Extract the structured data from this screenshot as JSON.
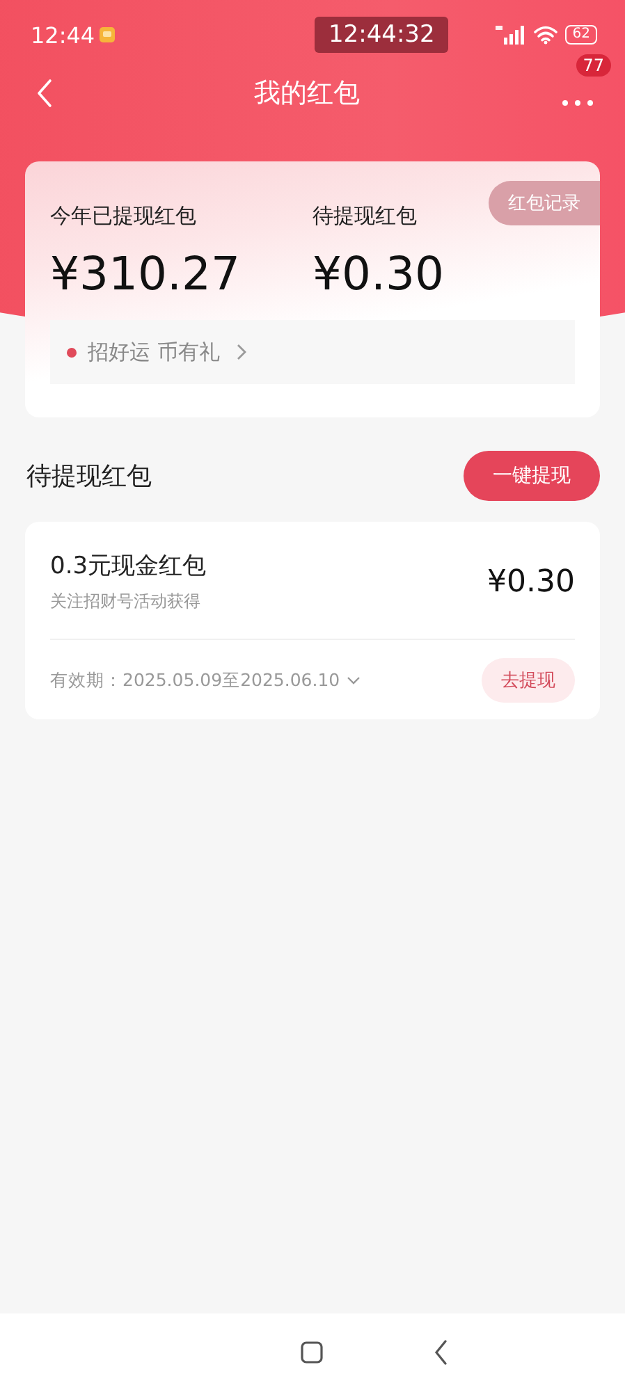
{
  "status_bar": {
    "time": "12:44",
    "clock": "12:44:32",
    "battery": "62"
  },
  "header": {
    "title": "我的红包",
    "badge": "77"
  },
  "summary": {
    "record_button": "红包记录",
    "stats": [
      {
        "label": "今年已提现红包",
        "amount": "¥310.27"
      },
      {
        "label": "待提现红包",
        "amount": "¥0.30"
      }
    ],
    "promo": "招好运 币有礼"
  },
  "pending": {
    "title": "待提现红包",
    "button": "一键提现",
    "items": [
      {
        "name": "0.3元现金红包",
        "source": "关注招财号活动获得",
        "amount": "¥0.30",
        "validity": "有效期：2025.05.09至2025.06.10",
        "button": "去提现"
      }
    ]
  }
}
